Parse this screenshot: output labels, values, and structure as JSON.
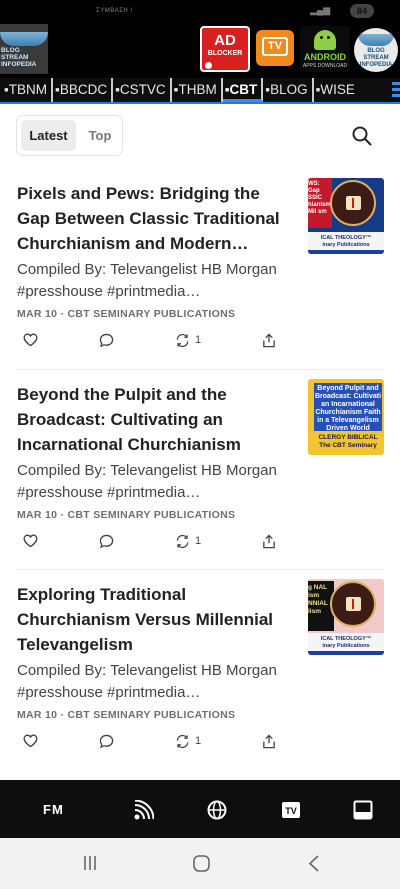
{
  "status": {
    "carrier": "ΣΥΜΒΑΣΗ Ι",
    "battery": "84"
  },
  "banner": {
    "left_logo": "BLOG STREAM INFOPEDIA",
    "ad": {
      "big": "AD",
      "small": "BLOCKER"
    },
    "tv": "TV",
    "android": {
      "title": "ANDROID",
      "sub": "APPS DOWNLOAD"
    },
    "right_logo": "BLOG STREAM INFOPEDIA"
  },
  "nav": {
    "items": [
      "TBNM",
      "BBCDC",
      "CSTVC",
      "THBM",
      "CBT",
      "BLOG",
      "WISE"
    ],
    "active": "CBT"
  },
  "tabs": {
    "latest": "Latest",
    "top": "Top"
  },
  "posts": [
    {
      "title": "Pixels and Pews: Bridging the Gap Between Classic Traditional Churchianism and Modern…",
      "subtitle": "Compiled By: Televangelist HB Morgan #presshouse #printmedia…",
      "meta": "MAR 10 · CBT SEMINARY PUBLICATIONS",
      "restacks": "1",
      "thumb": {
        "side": "WS: Gap SSIC hianism Mil sm",
        "band1": "ICAL THEOLOGY™",
        "band2": "inary Publications"
      }
    },
    {
      "title": "Beyond the Pulpit and the Broadcast: Cultivating an Incarnational Churchianism Fait…",
      "subtitle": "Compiled By: Televangelist HB Morgan #presshouse #printmedia…",
      "meta": "MAR 10 · CBT SEMINARY PUBLICATIONS",
      "restacks": "1",
      "thumb": {
        "box": "Beyond Pulpit and Broadcast: Cultivati an Incarnational Churchianism Faith in a Televangelism Driven World",
        "lower1": "CLERGY BIBLICAL",
        "lower2": "The CBT Seminary"
      }
    },
    {
      "title": "Exploring Traditional Churchianism Versus Millennial Televangelism",
      "subtitle": "Compiled By: Televangelist HB Morgan #presshouse #printmedia…",
      "meta": "MAR 10 · CBT SEMINARY PUBLICATIONS",
      "restacks": "1",
      "thumb": {
        "side": "g NAL ism NNIAL lism",
        "band1": "ICAL THEOLOGY™",
        "band2": "inary Publications"
      }
    }
  ],
  "appbar": {
    "fm": "FM",
    "icons": [
      "radio-broadcast-icon",
      "globe-icon",
      "tv-icon",
      "monitor-icon"
    ]
  },
  "colors": {
    "accent": "#3a8ee6",
    "nav_bg": "#0d0d0d",
    "appbar_bg": "#0e0e0e"
  }
}
